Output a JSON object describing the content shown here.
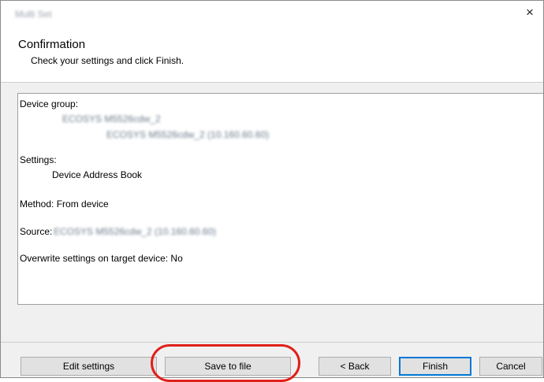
{
  "window": {
    "title": "Multi Set",
    "close_glyph": "×",
    "close_icon": "close-icon"
  },
  "header": {
    "title": "Confirmation",
    "subtitle": "Check your settings and click Finish."
  },
  "summary": {
    "device_group_label": "Device group:",
    "device_group_line1": "ECOSYS M5526cdw_2",
    "device_group_line2": "ECOSYS M5526cdw_2 (10.160.60.60)",
    "settings_label": "Settings:",
    "settings_value": "Device Address Book",
    "method": "Method: From device",
    "source_label": "Source:",
    "source_value": "ECOSYS M5526cdw_2 (10.160.60.60)",
    "overwrite": "Overwrite settings on target device: No"
  },
  "buttons": {
    "edit_settings": "Edit settings",
    "save_to_file": "Save to file",
    "back": "< Back",
    "finish": "Finish",
    "cancel": "Cancel"
  },
  "colors": {
    "highlight": "#e0201a",
    "default_button_border": "#0078d7"
  }
}
